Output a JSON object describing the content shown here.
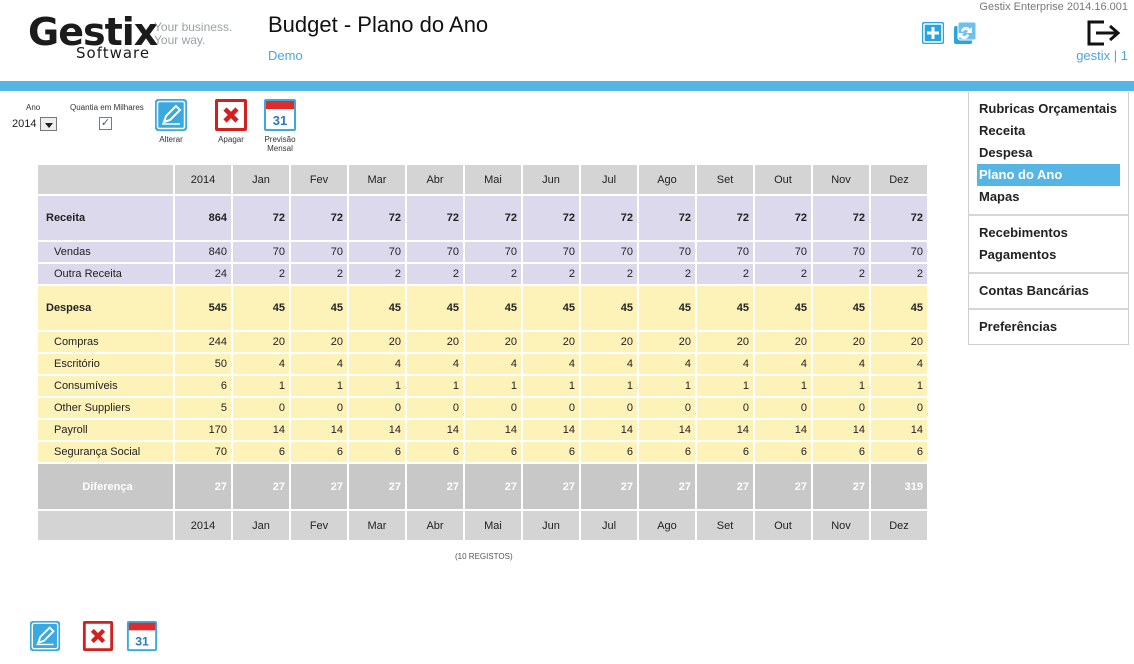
{
  "header": {
    "logo_main": "Gestix",
    "logo_sub": "Software",
    "tagline_1": "Your business.",
    "tagline_2": "Your way.",
    "title": "Budget - Plano do Ano",
    "company": "Demo",
    "version": "Gestix Enterprise 2014.16.001",
    "user": "gestix | 1",
    "icons": [
      "plus-icon",
      "refresh-icon",
      "logout-icon"
    ]
  },
  "controls": {
    "year_label": "Ano",
    "year_value": "2014",
    "thousands_label": "Quantia em Milhares",
    "thousands_checked": true,
    "edit_label": "Alterar",
    "delete_label": "Apagar",
    "forecast_label_1": "Previsão",
    "forecast_label_2": "Mensal",
    "calendar_day": "31"
  },
  "table": {
    "columns": [
      "2014",
      "Jan",
      "Fev",
      "Mar",
      "Abr",
      "Mai",
      "Jun",
      "Jul",
      "Ago",
      "Set",
      "Out",
      "Nov",
      "Dez"
    ],
    "rows": [
      {
        "label": "Receita",
        "kind": "rec-main",
        "values": [
          "864",
          "72",
          "72",
          "72",
          "72",
          "72",
          "72",
          "72",
          "72",
          "72",
          "72",
          "72",
          "72"
        ]
      },
      {
        "label": "Vendas",
        "kind": "rec",
        "values": [
          "840",
          "70",
          "70",
          "70",
          "70",
          "70",
          "70",
          "70",
          "70",
          "70",
          "70",
          "70",
          "70"
        ]
      },
      {
        "label": "Outra Receita",
        "kind": "rec",
        "values": [
          "24",
          "2",
          "2",
          "2",
          "2",
          "2",
          "2",
          "2",
          "2",
          "2",
          "2",
          "2",
          "2"
        ]
      },
      {
        "label": "Despesa",
        "kind": "des-main",
        "values": [
          "545",
          "45",
          "45",
          "45",
          "45",
          "45",
          "45",
          "45",
          "45",
          "45",
          "45",
          "45",
          "45"
        ]
      },
      {
        "label": "Compras",
        "kind": "des",
        "values": [
          "244",
          "20",
          "20",
          "20",
          "20",
          "20",
          "20",
          "20",
          "20",
          "20",
          "20",
          "20",
          "20"
        ]
      },
      {
        "label": "Escritório",
        "kind": "des",
        "values": [
          "50",
          "4",
          "4",
          "4",
          "4",
          "4",
          "4",
          "4",
          "4",
          "4",
          "4",
          "4",
          "4"
        ]
      },
      {
        "label": "Consumíveis",
        "kind": "des",
        "values": [
          "6",
          "1",
          "1",
          "1",
          "1",
          "1",
          "1",
          "1",
          "1",
          "1",
          "1",
          "1",
          "1"
        ]
      },
      {
        "label": "Other Suppliers",
        "kind": "des",
        "values": [
          "5",
          "0",
          "0",
          "0",
          "0",
          "0",
          "0",
          "0",
          "0",
          "0",
          "0",
          "0",
          "0"
        ]
      },
      {
        "label": "Payroll",
        "kind": "des",
        "values": [
          "170",
          "14",
          "14",
          "14",
          "14",
          "14",
          "14",
          "14",
          "14",
          "14",
          "14",
          "14",
          "14"
        ]
      },
      {
        "label": "Segurança Social",
        "kind": "des",
        "values": [
          "70",
          "6",
          "6",
          "6",
          "6",
          "6",
          "6",
          "6",
          "6",
          "6",
          "6",
          "6",
          "6"
        ]
      },
      {
        "label": "Diferença",
        "kind": "dif",
        "values": [
          "27",
          "27",
          "27",
          "27",
          "27",
          "27",
          "27",
          "27",
          "27",
          "27",
          "27",
          "27",
          "319"
        ]
      }
    ],
    "record_count": "(10 REGISTOS)"
  },
  "sidebar": {
    "groups": [
      {
        "items": [
          {
            "label": "Rubricas Orçamentais",
            "active": false
          },
          {
            "label": "Receita",
            "active": false
          },
          {
            "label": "Despesa",
            "active": false
          },
          {
            "label": "Plano do Ano",
            "active": true
          },
          {
            "label": "Mapas",
            "active": false
          }
        ]
      },
      {
        "items": [
          {
            "label": "Recebimentos",
            "active": false
          },
          {
            "label": "Pagamentos",
            "active": false
          }
        ]
      },
      {
        "items": [
          {
            "label": "Contas Bancárias",
            "active": false
          }
        ]
      },
      {
        "items": [
          {
            "label": "Preferências",
            "active": false
          }
        ]
      }
    ]
  },
  "colors": {
    "accent": "#55b6e6",
    "receita_bg": "#dcd9ec",
    "despesa_bg": "#fdf2b8",
    "diferenca_bg": "#c8c8c8",
    "delete_red": "#d21f1f"
  }
}
